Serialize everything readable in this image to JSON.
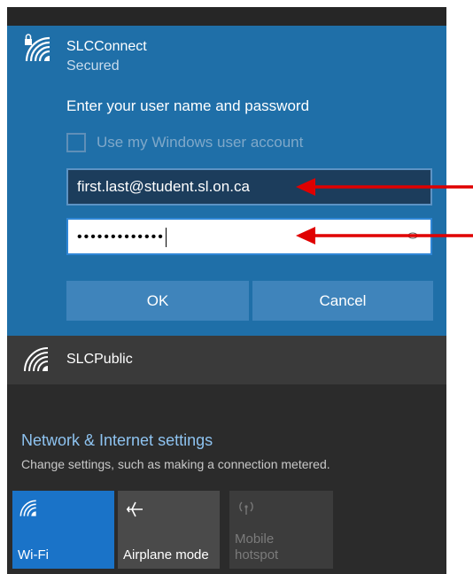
{
  "selected_network": {
    "name": "SLCConnect",
    "status": "Secured",
    "prompt": "Enter your user name and password",
    "use_windows_account_label": "Use my Windows user account",
    "username_value": "first.last@student.sl.on.ca",
    "password_mask": "•••••••••••••",
    "ok_label": "OK",
    "cancel_label": "Cancel"
  },
  "other_network": {
    "name": "SLCPublic"
  },
  "settings": {
    "title": "Network & Internet settings",
    "description": "Change settings, such as making a connection metered."
  },
  "quick_actions": [
    {
      "label": "Wi-Fi",
      "icon": "wifi-icon",
      "active": true
    },
    {
      "label": "Airplane mode",
      "icon": "airplane-icon",
      "active": false
    },
    {
      "label": "Mobile\nhotspot",
      "icon": "hotspot-icon",
      "active": false,
      "disabled": true
    }
  ],
  "colors": {
    "selected_bg": "#1f6fa8",
    "panel_bg": "#2b2b2b",
    "accent": "#1a73c8",
    "annotation_arrow": "#e00000"
  }
}
